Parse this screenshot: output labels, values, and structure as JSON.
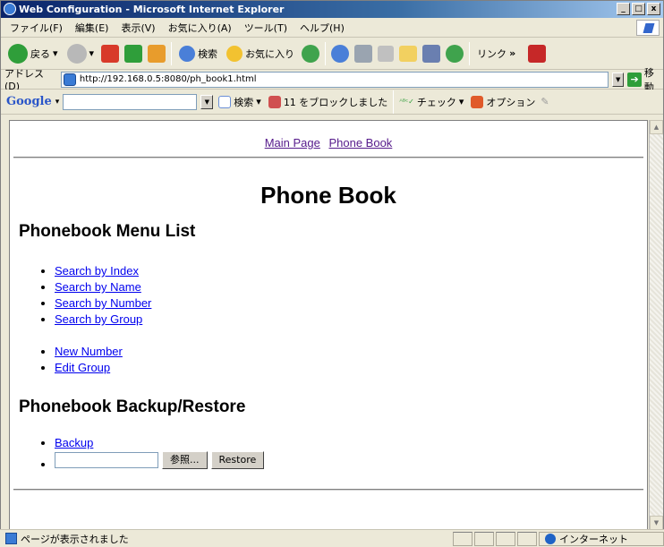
{
  "window": {
    "title": "Web Configuration - Microsoft Internet Explorer",
    "controls": [
      "_",
      "□",
      "x"
    ]
  },
  "menubar": {
    "items": [
      "ファイル(F)",
      "編集(E)",
      "表示(V)",
      "お気に入り(A)",
      "ツール(T)",
      "ヘルプ(H)"
    ]
  },
  "toolbar": {
    "back": "戻る",
    "search": "検索",
    "favorites": "お気に入り",
    "links": "リンク",
    "chevron": "»"
  },
  "address": {
    "label": "アドレス(D)",
    "url": "http://192.168.0.5:8080/ph_book1.html",
    "go": "移動"
  },
  "google": {
    "logo": "Google",
    "search": "検索",
    "blocked": "11 をブロックしました",
    "check": "チェック",
    "options": "オプション"
  },
  "page": {
    "nav": [
      "Main Page",
      "Phone Book"
    ],
    "title": "Phone Book",
    "menu_heading": "Phonebook Menu List",
    "search_links": [
      "Search by Index",
      "Search by Name",
      "Search by Number",
      "Search by Group"
    ],
    "edit_links": [
      "New Number",
      "Edit Group"
    ],
    "backup_heading": "Phonebook Backup/Restore",
    "backup_link": "Backup",
    "browse_label": "参照...",
    "restore_label": "Restore"
  },
  "status": {
    "text": "ページが表示されました",
    "zone": "インターネット"
  }
}
